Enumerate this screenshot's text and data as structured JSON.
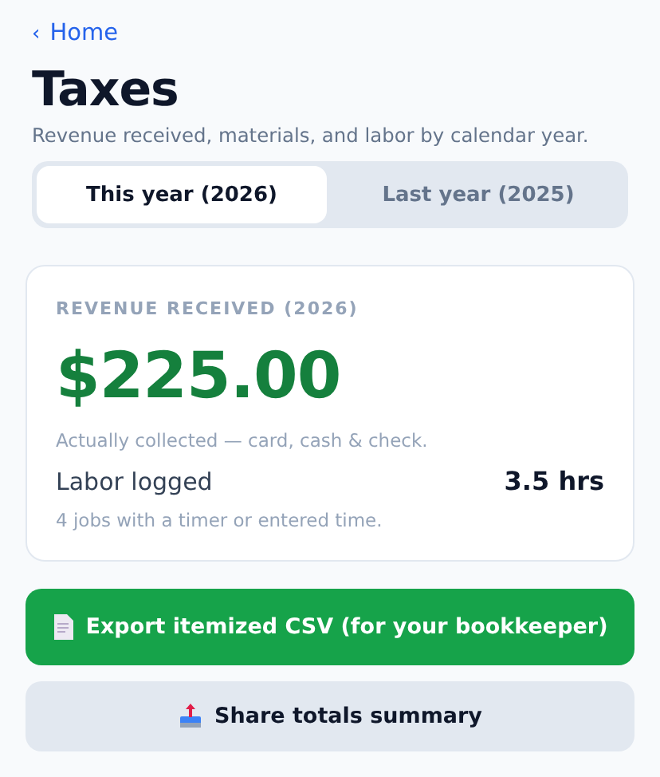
{
  "back_link": {
    "label": "Home",
    "icon": "‹"
  },
  "title": "Taxes",
  "subtitle": "Revenue received, materials, and labor by calendar year.",
  "tabs": [
    {
      "label": "This year (2026)",
      "selected": true
    },
    {
      "label": "Last year (2025)",
      "selected": false
    }
  ],
  "card": {
    "heading": "REVENUE RECEIVED (2026)",
    "amount": "$225.00",
    "amount_note": "Actually collected — card, cash & check.",
    "metric_label": "Labor logged",
    "metric_value": "3.5 hrs",
    "metric_note": "4 jobs with a timer or entered time."
  },
  "buttons": [
    {
      "label": "Export itemized CSV (for your bookkeeper)",
      "kind": "primary"
    },
    {
      "label": "Share totals summary",
      "kind": "secondary"
    }
  ]
}
